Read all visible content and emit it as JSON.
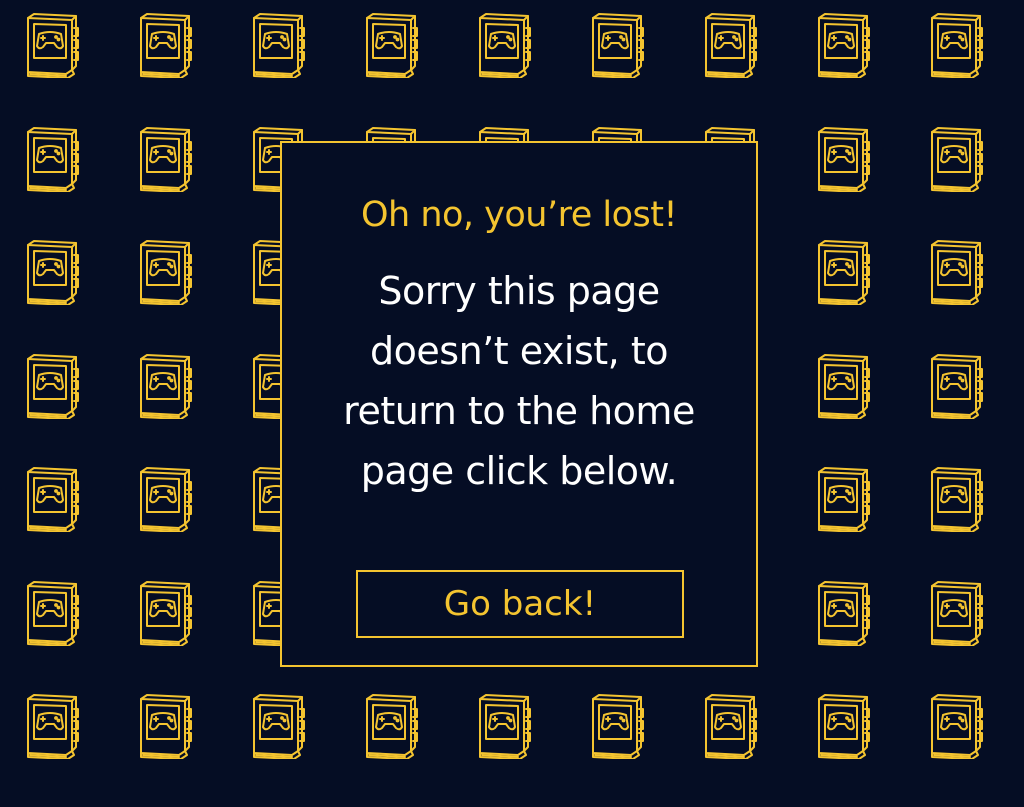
{
  "error_card": {
    "headline": "Oh no, you’re lost!",
    "message": "Sorry this page doesn’t exist, to return to the home page click below.",
    "button_label": "Go back!"
  },
  "background": {
    "icon": "game-book-icon",
    "color": "#050d24"
  },
  "colors": {
    "accent": "#f4c430",
    "text": "#ffffff",
    "background": "#050d24"
  }
}
